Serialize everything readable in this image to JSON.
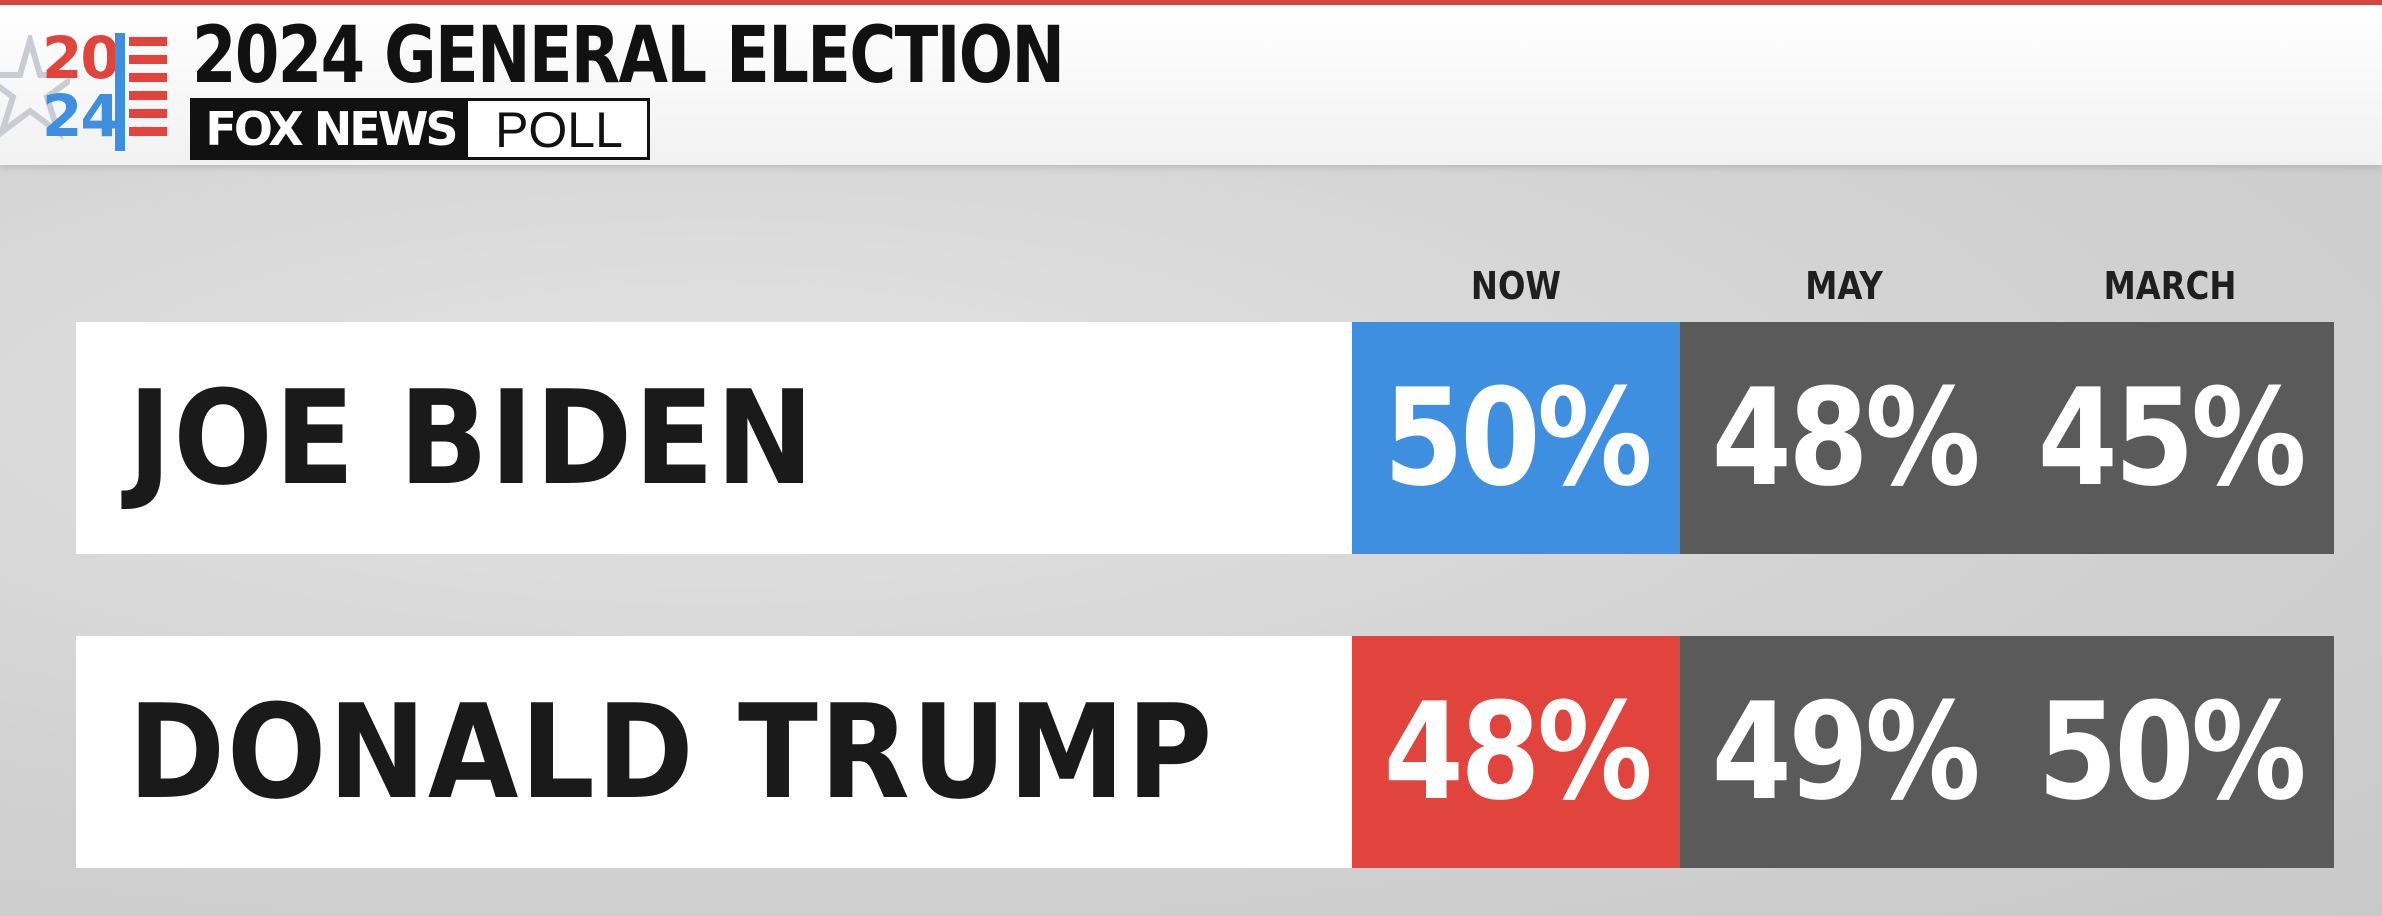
{
  "header": {
    "logo_year_top": "20",
    "logo_year_bottom": "24",
    "title": "2024 GENERAL ELECTION",
    "brand": "FOX NEWS",
    "brand_suffix": "POLL"
  },
  "colors": {
    "biden_now": "#3f8fe0",
    "trump_now": "#e0443c",
    "prior": "#5a5a5a"
  },
  "chart_data": {
    "type": "table",
    "columns": [
      "NOW",
      "MAY",
      "MARCH"
    ],
    "rows": [
      {
        "name": "JOE BIDEN",
        "values": [
          "50%",
          "48%",
          "45%"
        ]
      },
      {
        "name": "DONALD TRUMP",
        "values": [
          "48%",
          "49%",
          "50%"
        ]
      }
    ]
  }
}
